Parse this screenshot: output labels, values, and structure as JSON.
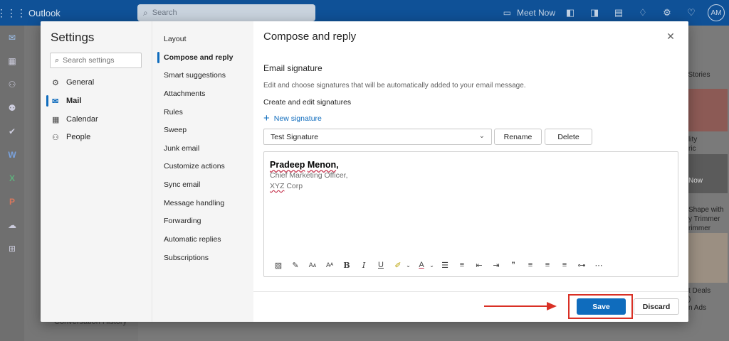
{
  "topbar": {
    "app_name": "Outlook",
    "search_placeholder": "Search",
    "meet_now": "Meet Now",
    "avatar_initials": "AM"
  },
  "background": {
    "conversation_history": "Conversation History",
    "right_pane_texts": [
      "d Stories",
      "lity",
      "ric",
      "Now",
      "Shape with",
      "y Trimmer",
      "rimmer",
      "t Deals",
      ")",
      "n Ads"
    ]
  },
  "settings": {
    "title": "Settings",
    "search_placeholder": "Search settings",
    "categories": [
      {
        "label": "General",
        "icon": "gear-icon"
      },
      {
        "label": "Mail",
        "icon": "mail-icon",
        "selected": true
      },
      {
        "label": "Calendar",
        "icon": "calendar-icon"
      },
      {
        "label": "People",
        "icon": "people-icon"
      }
    ],
    "mail_sections": [
      "Layout",
      "Compose and reply",
      "Smart suggestions",
      "Attachments",
      "Rules",
      "Sweep",
      "Junk email",
      "Customize actions",
      "Sync email",
      "Message handling",
      "Forwarding",
      "Automatic replies",
      "Subscriptions"
    ],
    "selected_section": "Compose and reply"
  },
  "content": {
    "title": "Compose and reply",
    "section_title": "Email signature",
    "section_desc": "Edit and choose signatures that will be automatically added to your email message.",
    "sub_title": "Create and edit signatures",
    "new_signature": "New signature",
    "selected_signature": "Test Signature",
    "rename_label": "Rename",
    "delete_label": "Delete",
    "signature": {
      "name_first": "Pradeep",
      "name_last": "Menon",
      "name_suffix": ",",
      "title": "Chief Marketing Officer,",
      "company_a": "XYZ",
      "company_b": " Corp"
    },
    "save_label": "Save",
    "discard_label": "Discard"
  },
  "colors": {
    "accent": "#0f6cbd",
    "topbar": "#0f5197",
    "annotation": "#d93025"
  }
}
